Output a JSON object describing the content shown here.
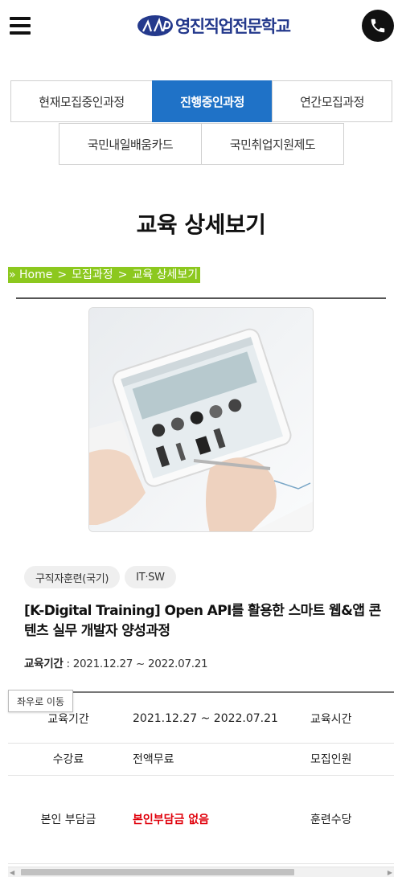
{
  "header": {
    "menu_icon": "hamburger-icon",
    "logo_text": "영진직업전문학교",
    "phone_icon": "phone-icon"
  },
  "tabs": {
    "row1": [
      {
        "label": "현재모집중인과정",
        "active": false
      },
      {
        "label": "진행중인과정",
        "active": true
      },
      {
        "label": "연간모집과정",
        "active": false
      }
    ],
    "row2": [
      {
        "label": "국민내일배움카드",
        "active": false
      },
      {
        "label": "국민취업지원제도",
        "active": false
      }
    ]
  },
  "page_title": "교육 상세보기",
  "breadcrumb": {
    "prefix": "»",
    "items": [
      "Home",
      "모집과정",
      "교육 상세보기"
    ],
    "separator": ">"
  },
  "course": {
    "tags": [
      "구직자훈련(국기)",
      "IT·SW"
    ],
    "title": "[K-Digital Training] Open API를 활용한 스마트 웹&앱 콘텐츠 실무 개발자 양성과정",
    "period_label": "교육기간",
    "period_value": ": 2021.12.27 ~ 2022.07.21"
  },
  "scroll_hint": "좌우로 이동",
  "info_table": [
    {
      "label": "교육기간",
      "value": "2021.12.27 ~ 2022.07.21",
      "label2": "교육시간"
    },
    {
      "label": "수강료",
      "value": "전액무료",
      "label2": "모집인원"
    },
    {
      "label": "본인 부담금",
      "value": "본인부담금 없음",
      "label2": "훈련수당"
    }
  ],
  "colors": {
    "accent_blue": "#1f72c7",
    "breadcrumb_green": "#8cc81e",
    "logo_navy": "#24398c",
    "highlight_red": "#e0000b"
  }
}
